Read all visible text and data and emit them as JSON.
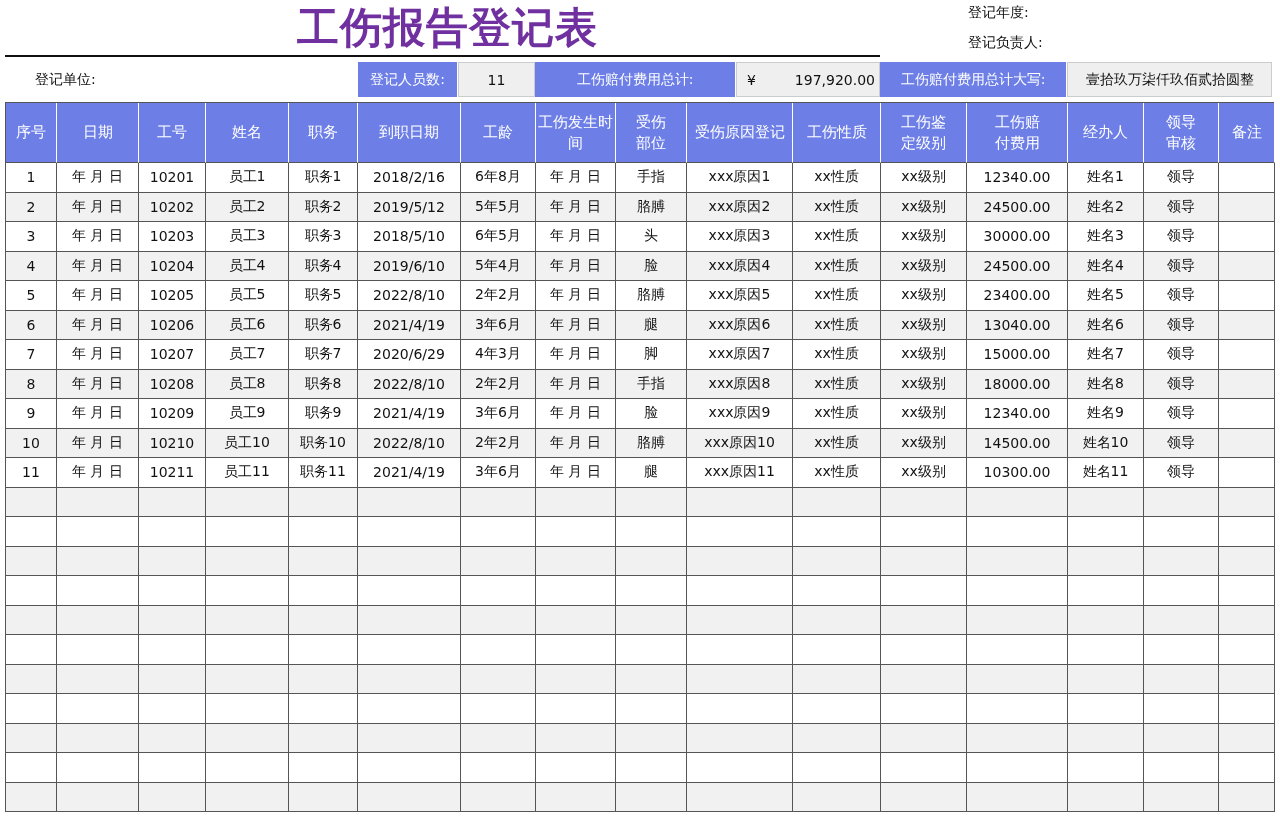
{
  "title": "工伤报告登记表",
  "meta": [
    {
      "label": "登记年度:"
    },
    {
      "label": "登记负责人:"
    }
  ],
  "info": {
    "unit_label": "登记单位:",
    "items": [
      {
        "kind": "label",
        "text": "登记人员数:"
      },
      {
        "kind": "value",
        "text": "11"
      },
      {
        "kind": "label",
        "text": "工伤赔付费用总计:"
      },
      {
        "kind": "money",
        "symbol": "¥",
        "amount": "197,920.00"
      },
      {
        "kind": "label",
        "text": "工伤赔付费用总计大写:"
      },
      {
        "kind": "value",
        "text": "壹拾玖万柒仟玖佰贰拾圆整"
      }
    ]
  },
  "table": {
    "columns": [
      "序号",
      "日期",
      "工号",
      "姓名",
      "职务",
      "到职日期",
      "工龄",
      "工伤发生时间",
      "受伤部位",
      "受伤原因登记",
      "工伤性质",
      "工伤鉴定级别",
      "工伤赔付费用",
      "经办人",
      "领导审核",
      "备注"
    ],
    "rows": [
      [
        "1",
        "年 月 日",
        "10201",
        "员工1",
        "职务1",
        "2018/2/16",
        "6年8月",
        "年 月 日",
        "手指",
        "xxx原因1",
        "xx性质",
        "xx级别",
        "12340.00",
        "姓名1",
        "领导"
      ],
      [
        "2",
        "年 月 日",
        "10202",
        "员工2",
        "职务2",
        "2019/5/12",
        "5年5月",
        "年 月 日",
        "胳膊",
        "xxx原因2",
        "xx性质",
        "xx级别",
        "24500.00",
        "姓名2",
        "领导"
      ],
      [
        "3",
        "年 月 日",
        "10203",
        "员工3",
        "职务3",
        "2018/5/10",
        "6年5月",
        "年 月 日",
        "头",
        "xxx原因3",
        "xx性质",
        "xx级别",
        "30000.00",
        "姓名3",
        "领导"
      ],
      [
        "4",
        "年 月 日",
        "10204",
        "员工4",
        "职务4",
        "2019/6/10",
        "5年4月",
        "年 月 日",
        "脸",
        "xxx原因4",
        "xx性质",
        "xx级别",
        "24500.00",
        "姓名4",
        "领导"
      ],
      [
        "5",
        "年 月 日",
        "10205",
        "员工5",
        "职务5",
        "2022/8/10",
        "2年2月",
        "年 月 日",
        "胳膊",
        "xxx原因5",
        "xx性质",
        "xx级别",
        "23400.00",
        "姓名5",
        "领导"
      ],
      [
        "6",
        "年 月 日",
        "10206",
        "员工6",
        "职务6",
        "2021/4/19",
        "3年6月",
        "年 月 日",
        "腿",
        "xxx原因6",
        "xx性质",
        "xx级别",
        "13040.00",
        "姓名6",
        "领导"
      ],
      [
        "7",
        "年 月 日",
        "10207",
        "员工7",
        "职务7",
        "2020/6/29",
        "4年3月",
        "年 月 日",
        "脚",
        "xxx原因7",
        "xx性质",
        "xx级别",
        "15000.00",
        "姓名7",
        "领导"
      ],
      [
        "8",
        "年 月 日",
        "10208",
        "员工8",
        "职务8",
        "2022/8/10",
        "2年2月",
        "年 月 日",
        "手指",
        "xxx原因8",
        "xx性质",
        "xx级别",
        "18000.00",
        "姓名8",
        "领导"
      ],
      [
        "9",
        "年 月 日",
        "10209",
        "员工9",
        "职务9",
        "2021/4/19",
        "3年6月",
        "年 月 日",
        "脸",
        "xxx原因9",
        "xx性质",
        "xx级别",
        "12340.00",
        "姓名9",
        "领导"
      ],
      [
        "10",
        "年 月 日",
        "10210",
        "员工10",
        "职务10",
        "2022/8/10",
        "2年2月",
        "年 月 日",
        "胳膊",
        "xxx原因10",
        "xx性质",
        "xx级别",
        "14500.00",
        "姓名10",
        "领导"
      ],
      [
        "11",
        "年 月 日",
        "10211",
        "员工11",
        "职务11",
        "2021/4/19",
        "3年6月",
        "年 月 日",
        "腿",
        "xxx原因11",
        "xx性质",
        "xx级别",
        "10300.00",
        "姓名11",
        "领导"
      ]
    ]
  }
}
